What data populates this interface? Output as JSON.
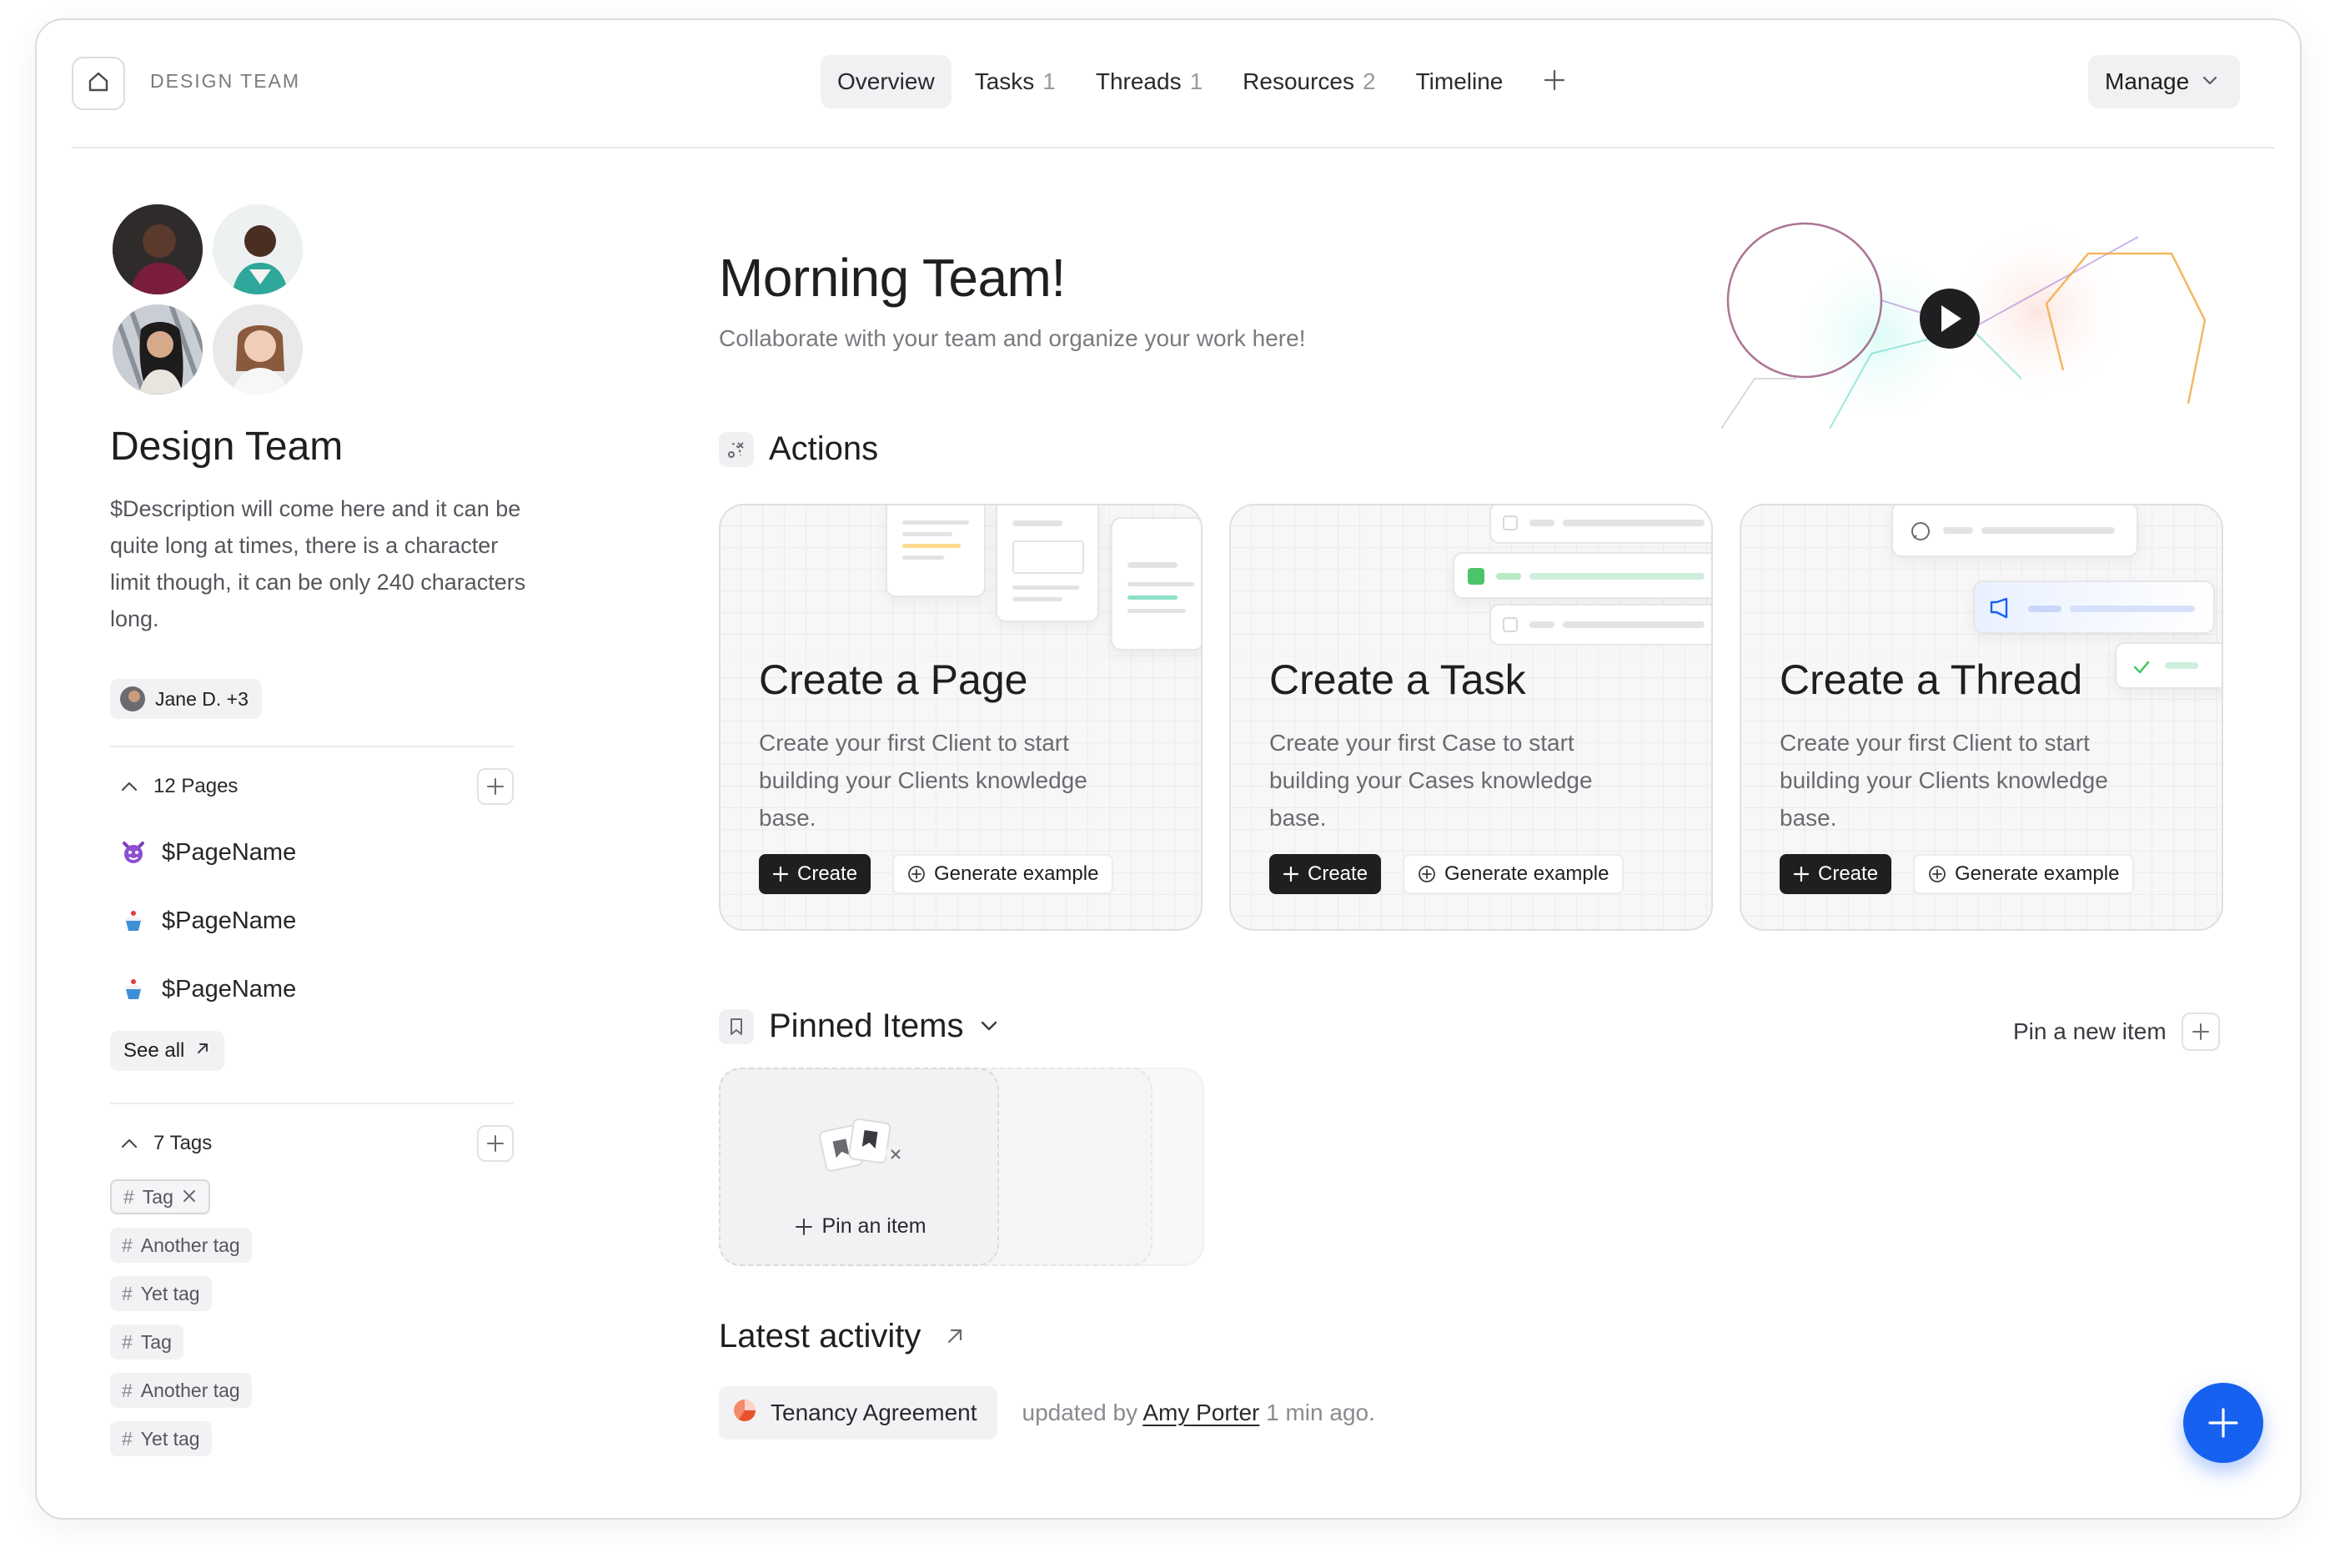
{
  "header": {
    "brand": "DESIGN TEAM",
    "tabs": [
      {
        "label": "Overview",
        "count": ""
      },
      {
        "label": "Tasks",
        "count": "1"
      },
      {
        "label": "Threads",
        "count": "1"
      },
      {
        "label": "Resources",
        "count": "2"
      },
      {
        "label": "Timeline",
        "count": ""
      }
    ],
    "manage_label": "Manage"
  },
  "sidebar": {
    "team_name": "Design Team",
    "description": "$Description will come here and it can be quite long at times, there is a character limit though, it can be only 240 characters long.",
    "members_label": "Jane D. +3",
    "pages": {
      "header": "12 Pages",
      "items": [
        {
          "label": "$PageName",
          "icon": "devil-emoji-icon"
        },
        {
          "label": "$PageName",
          "icon": "cupcake-emoji-icon"
        },
        {
          "label": "$PageName",
          "icon": "cupcake-emoji-icon"
        }
      ],
      "see_all": "See all"
    },
    "tags": {
      "header": "7 Tags",
      "items": [
        "Tag",
        "Another tag",
        "Yet tag",
        "Tag",
        "Another tag",
        "Yet tag"
      ]
    }
  },
  "main": {
    "greeting": "Morning Team!",
    "subtitle": "Collaborate with your team and organize your work here!",
    "actions_title": "Actions",
    "cards": [
      {
        "title": "Create a Page",
        "desc": "Create your first Client to start building your Clients knowledge base.",
        "create": "Create",
        "generate": "Generate example"
      },
      {
        "title": "Create a Task",
        "desc": "Create your first Case to start building your Cases knowledge base.",
        "create": "Create",
        "generate": "Generate example"
      },
      {
        "title": "Create a Thread",
        "desc": "Create your first Client to start building your Clients knowledge base.",
        "create": "Create",
        "generate": "Generate example"
      }
    ],
    "pinned_title": "Pinned Items",
    "pin_new": "Pin a new item",
    "pin_item": "Pin an item",
    "latest_title": "Latest activity",
    "activity": {
      "doc": "Tenancy Agreement",
      "updated_by": "updated by",
      "user": "Amy Porter",
      "time": "1 min ago."
    }
  },
  "colors": {
    "accent": "#1661f0",
    "dark_button": "#1f1f22",
    "activity_dot": "#f0603a"
  }
}
